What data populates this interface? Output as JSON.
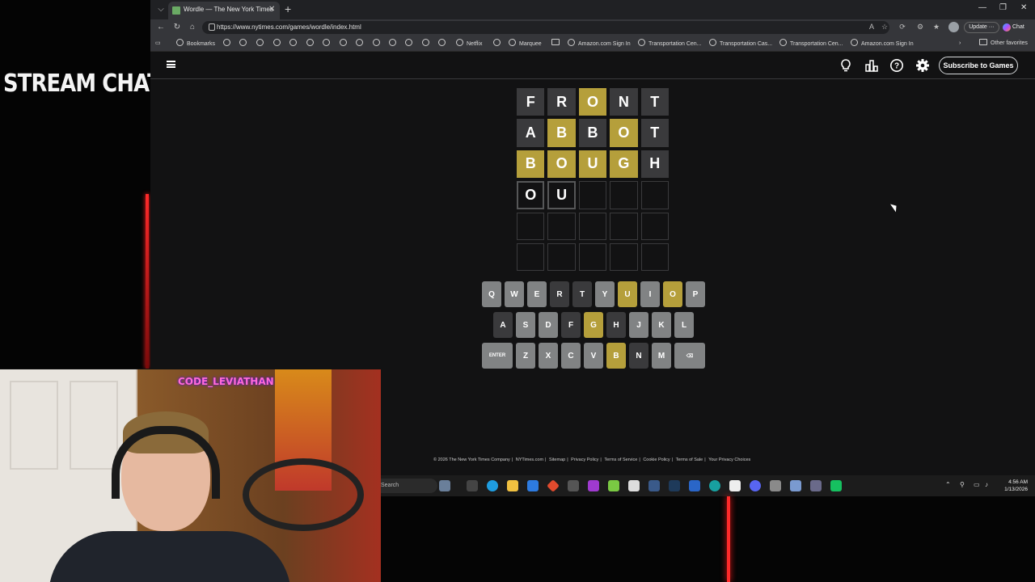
{
  "overlay": {
    "stream_title": "STREAM CHAT",
    "cam_label": "CODE_LEVIATHAN"
  },
  "browser": {
    "tab_title": "Wordle — The New York Times",
    "url": "https://www.nytimes.com/games/wordle/index.html",
    "update_label": "Update",
    "chat_label": "Chat",
    "bookmarks": [
      "Bookmarks",
      "Netflix",
      "Marquee",
      "Amazon.com Sign In",
      "Transportation Cen...",
      "Transportation Cas...",
      "Transportation Cen...",
      "Amazon.com Sign In"
    ],
    "other_favorites": "Other favorites"
  },
  "nyt": {
    "subscribe_label": "Subscribe to Games",
    "icons": [
      "lightbulb-icon",
      "stats-icon",
      "help-icon",
      "settings-icon"
    ]
  },
  "board": [
    [
      [
        "F",
        "absent"
      ],
      [
        "R",
        "absent"
      ],
      [
        "O",
        "present"
      ],
      [
        "N",
        "absent"
      ],
      [
        "T",
        "absent"
      ]
    ],
    [
      [
        "A",
        "absent"
      ],
      [
        "B",
        "present"
      ],
      [
        "B",
        "absent"
      ],
      [
        "O",
        "present"
      ],
      [
        "T",
        "absent"
      ]
    ],
    [
      [
        "B",
        "present"
      ],
      [
        "O",
        "present"
      ],
      [
        "U",
        "present"
      ],
      [
        "G",
        "present"
      ],
      [
        "H",
        "absent"
      ]
    ],
    [
      [
        "O",
        "tbd"
      ],
      [
        "U",
        "tbd"
      ],
      [
        "",
        "empty"
      ],
      [
        "",
        "empty"
      ],
      [
        "",
        "empty"
      ]
    ],
    [
      [
        "",
        "empty"
      ],
      [
        "",
        "empty"
      ],
      [
        "",
        "empty"
      ],
      [
        "",
        "empty"
      ],
      [
        "",
        "empty"
      ]
    ],
    [
      [
        "",
        "empty"
      ],
      [
        "",
        "empty"
      ],
      [
        "",
        "empty"
      ],
      [
        "",
        "empty"
      ],
      [
        "",
        "empty"
      ]
    ]
  ],
  "keyboard": [
    [
      [
        "Q",
        ""
      ],
      [
        "W",
        ""
      ],
      [
        "E",
        ""
      ],
      [
        "R",
        "absent"
      ],
      [
        "T",
        "absent"
      ],
      [
        "Y",
        ""
      ],
      [
        "U",
        "present"
      ],
      [
        "I",
        ""
      ],
      [
        "O",
        "present"
      ],
      [
        "P",
        ""
      ]
    ],
    [
      [
        "A",
        "absent"
      ],
      [
        "S",
        ""
      ],
      [
        "D",
        ""
      ],
      [
        "F",
        "absent"
      ],
      [
        "G",
        "present"
      ],
      [
        "H",
        "absent"
      ],
      [
        "J",
        ""
      ],
      [
        "K",
        ""
      ],
      [
        "L",
        ""
      ]
    ],
    [
      [
        "ENTER",
        "wide"
      ],
      [
        "Z",
        ""
      ],
      [
        "X",
        ""
      ],
      [
        "C",
        ""
      ],
      [
        "V",
        ""
      ],
      [
        "B",
        "present"
      ],
      [
        "N",
        "absent"
      ],
      [
        "M",
        ""
      ],
      [
        "⌫",
        "wide"
      ]
    ]
  ],
  "footer": [
    "© 2026 The New York Times Company",
    "NYTimes.com",
    "Sitemap",
    "Privacy Policy",
    "Terms of Service",
    "Cookie Policy",
    "Terms of Sale",
    "Your Privacy Choices"
  ],
  "taskbar": {
    "search": "Search",
    "time": "4:56 AM",
    "date": "1/13/2026"
  },
  "colors": {
    "absent": "#3a3a3c",
    "present": "#b59f3b",
    "key": "#818384",
    "background": "#121213"
  }
}
